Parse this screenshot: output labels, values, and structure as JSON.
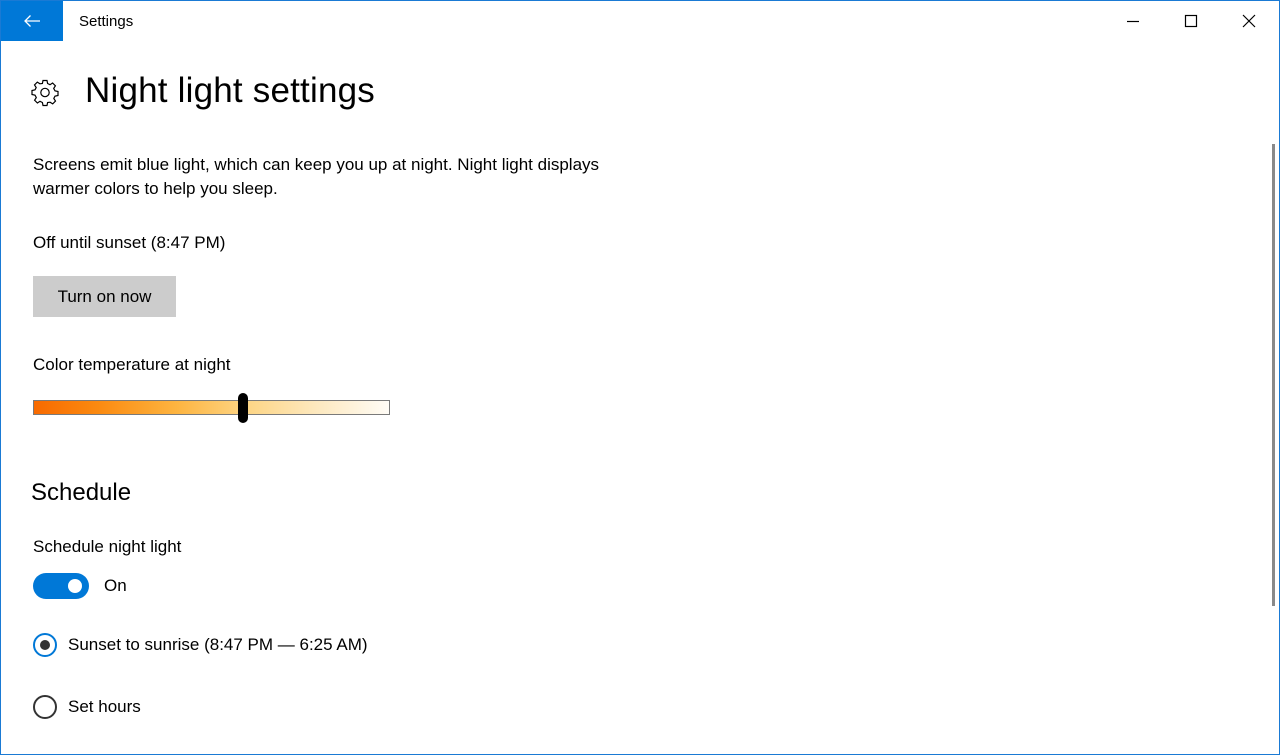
{
  "window": {
    "title": "Settings",
    "accent_color": "#0078d7",
    "back_icon": "arrow-left-icon",
    "caption_icons": [
      "minimize-icon",
      "maximize-icon",
      "close-icon"
    ]
  },
  "page": {
    "icon": "gear-icon",
    "title": "Night light settings",
    "description": "Screens emit blue light, which can keep you up at night. Night light displays warmer colors to help you sleep.",
    "status": "Off until sunset (8:47 PM)",
    "turn_on_button": "Turn on now",
    "color_temperature": {
      "label": "Color temperature at night",
      "value_fraction": 0.59
    }
  },
  "schedule": {
    "heading": "Schedule",
    "toggle_label": "Schedule night light",
    "toggle_state": "On",
    "toggle_on": true,
    "options": [
      {
        "label": "Sunset to sunrise (8:47 PM — 6:25 AM)",
        "selected": true
      },
      {
        "label": "Set hours",
        "selected": false
      }
    ]
  }
}
